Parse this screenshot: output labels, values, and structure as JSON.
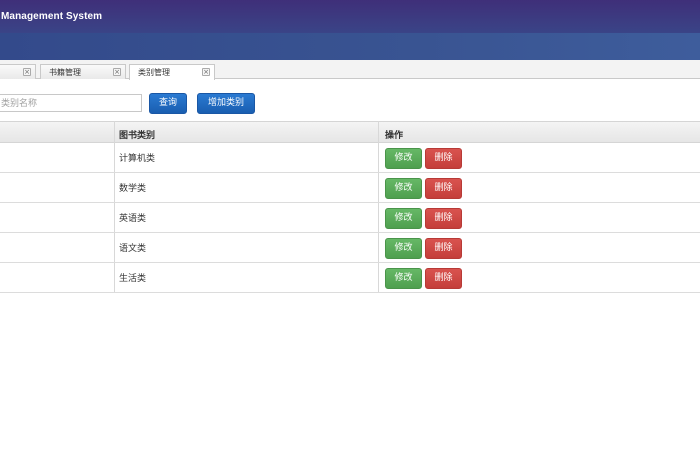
{
  "header": {
    "title": "Management System"
  },
  "tabs": [
    {
      "label": "",
      "close": "×"
    },
    {
      "label": "书籍管理",
      "close": "×"
    },
    {
      "label": "类别管理",
      "close": "×"
    }
  ],
  "toolbar": {
    "search_placeholder": "类别名称",
    "search_value": "",
    "query_label": "查询",
    "add_label": "增加类别"
  },
  "table": {
    "columns": [
      "",
      "图书类别",
      "操作"
    ],
    "rows": [
      {
        "category": "计算机类",
        "edit": "修改",
        "delete": "删除"
      },
      {
        "category": "数学类",
        "edit": "修改",
        "delete": "删除"
      },
      {
        "category": "英语类",
        "edit": "修改",
        "delete": "删除"
      },
      {
        "category": "语文类",
        "edit": "修改",
        "delete": "删除"
      },
      {
        "category": "生活类",
        "edit": "修改",
        "delete": "删除"
      }
    ]
  },
  "colors": {
    "header_gradient_start": "#3f2f79",
    "header_gradient_end": "#2f5c9a",
    "primary_button": "#1a5eb0",
    "edit_button": "#5cb85c",
    "delete_button": "#d9534f"
  }
}
